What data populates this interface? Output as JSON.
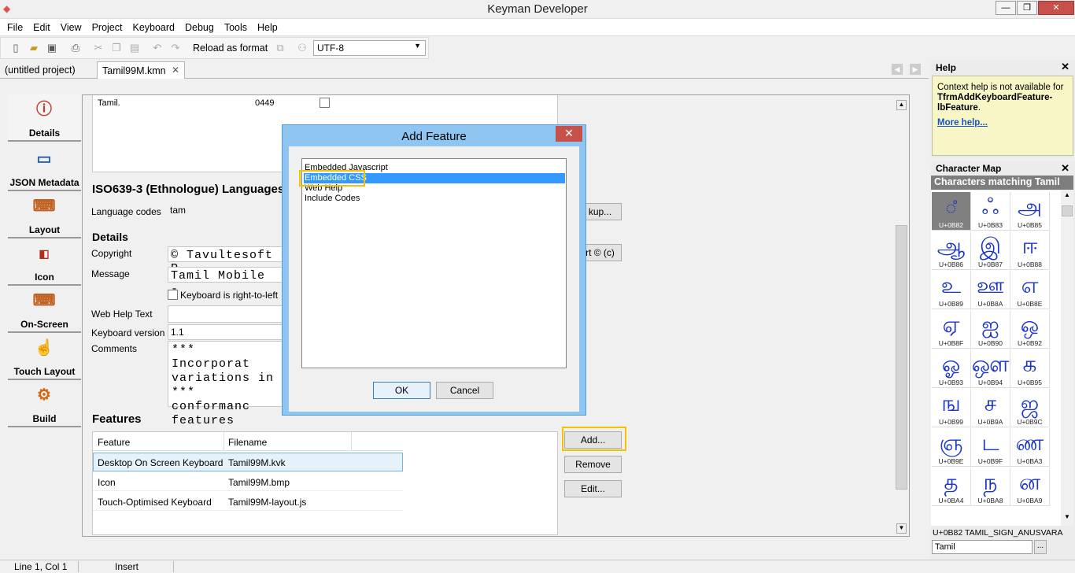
{
  "window": {
    "title": "Keyman Developer"
  },
  "menu": [
    "File",
    "Edit",
    "View",
    "Project",
    "Keyboard",
    "Debug",
    "Tools",
    "Help"
  ],
  "toolbar": {
    "reload_label": "Reload as format",
    "encoding": "UTF-8"
  },
  "tabs": [
    {
      "label": "(untitled project)"
    },
    {
      "label": "Tamil99M.kmn"
    }
  ],
  "nav": [
    {
      "label": "Details",
      "icon": "info-icon"
    },
    {
      "label": "JSON Metadata",
      "icon": "metadata-icon"
    },
    {
      "label": "Layout",
      "icon": "keyboard-icon"
    },
    {
      "label": "Icon",
      "icon": "image-icon"
    },
    {
      "label": "On-Screen",
      "icon": "onscreen-keyboard-icon"
    },
    {
      "label": "Touch Layout",
      "icon": "touch-icon"
    },
    {
      "label": "Build",
      "icon": "gear-icon"
    }
  ],
  "languages_table": {
    "row": {
      "name": "Tamil.",
      "id": "0449"
    }
  },
  "iso": {
    "title": "ISO639-3 (Ethnologue) Languages",
    "codes_label": "Language codes",
    "codes_value": "tam",
    "lookup_label": "kup..."
  },
  "details": {
    "title": "Details",
    "copyright_label": "Copyright",
    "copyright_value": "© Tavultesoft P",
    "insert_copyright_label": "rt © (c)",
    "message_label": "Message",
    "message_value": "Tamil Mobile -",
    "rtl_label": "Keyboard is right-to-left",
    "webhelp_label": "Web Help Text",
    "version_label": "Keyboard version",
    "version_value": "1.1",
    "comments_label": "Comments",
    "comments_lines": [
      "*** Incorporat",
      "variations in",
      "*** conformanc",
      "features"
    ]
  },
  "features": {
    "title": "Features",
    "headers": [
      "Feature",
      "Filename"
    ],
    "rows": [
      {
        "feature": "Desktop On Screen Keyboard",
        "file": "Tamil99M.kvk"
      },
      {
        "feature": "Icon",
        "file": "Tamil99M.bmp"
      },
      {
        "feature": "Touch-Optimised Keyboard",
        "file": "Tamil99M-layout.js"
      }
    ],
    "add_label": "Add...",
    "remove_label": "Remove",
    "edit_label": "Edit..."
  },
  "dialog": {
    "title": "Add Feature",
    "items": [
      "Embedded Javascript",
      "Embedded CSS",
      "Web Help",
      "Include Codes"
    ],
    "selected_index": 1,
    "ok_label": "OK",
    "cancel_label": "Cancel"
  },
  "help": {
    "title": "Help",
    "text": "Context help is not available for",
    "topic": "TfrmAddKeyboardFeature-lbFeature",
    "topic_suffix": ".",
    "more_link": "More help..."
  },
  "charmap": {
    "title": "Character Map",
    "header": "Characters matching Tamil",
    "cells": [
      {
        "g": "◌ஂ",
        "c": "U+0B82"
      },
      {
        "g": "ஃ",
        "c": "U+0B83"
      },
      {
        "g": "அ",
        "c": "U+0B85"
      },
      {
        "g": "ஆ",
        "c": "U+0B86"
      },
      {
        "g": "இ",
        "c": "U+0B87"
      },
      {
        "g": "ஈ",
        "c": "U+0B88"
      },
      {
        "g": "உ",
        "c": "U+0B89"
      },
      {
        "g": "ஊ",
        "c": "U+0B8A"
      },
      {
        "g": "எ",
        "c": "U+0B8E"
      },
      {
        "g": "ஏ",
        "c": "U+0B8F"
      },
      {
        "g": "ஐ",
        "c": "U+0B90"
      },
      {
        "g": "ஒ",
        "c": "U+0B92"
      },
      {
        "g": "ஓ",
        "c": "U+0B93"
      },
      {
        "g": "ஔ",
        "c": "U+0B94"
      },
      {
        "g": "க",
        "c": "U+0B95"
      },
      {
        "g": "ங",
        "c": "U+0B99"
      },
      {
        "g": "ச",
        "c": "U+0B9A"
      },
      {
        "g": "ஜ",
        "c": "U+0B9C"
      },
      {
        "g": "ஞ",
        "c": "U+0B9E"
      },
      {
        "g": "ட",
        "c": "U+0B9F"
      },
      {
        "g": "ண",
        "c": "U+0BA3"
      },
      {
        "g": "த",
        "c": "U+0BA4"
      },
      {
        "g": "ந",
        "c": "U+0BA8"
      },
      {
        "g": "ன",
        "c": "U+0BA9"
      }
    ],
    "status": "U+0B82 TAMIL_SIGN_ANUSVARA",
    "search_value": "Tamil",
    "search_button": "..."
  },
  "status": {
    "position": "Line 1, Col 1",
    "mode": "Insert"
  }
}
